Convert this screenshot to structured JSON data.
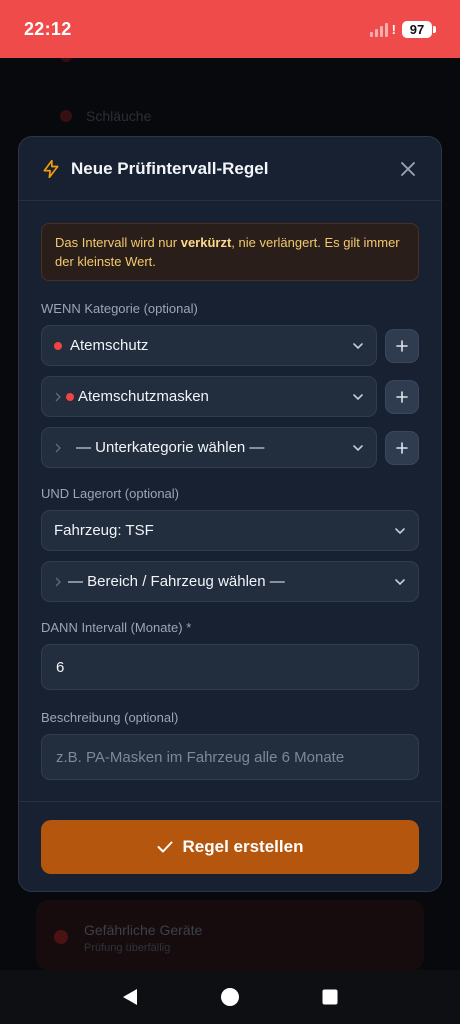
{
  "status_bar": {
    "time": "22:12",
    "battery": "97"
  },
  "background": {
    "items": [
      {
        "title": "Schläuche"
      }
    ],
    "card": {
      "title": "Gefährliche Geräte",
      "subtitle": "Prüfung überfällig"
    }
  },
  "modal": {
    "title": "Neue Prüfintervall-Regel",
    "close_icon": "close-icon",
    "header_icon": "bolt-icon",
    "accent_color": "#f59e0b",
    "info": {
      "before": "Das Intervall wird nur ",
      "bold": "verkürzt",
      "after": ", nie verlängert. Es gilt immer der kleinste Wert."
    },
    "category": {
      "label": "WENN Kategorie (optional)",
      "level1": "Atemschutz",
      "level2": "Atemschutzmasken",
      "level3": "— Unterkategorie wählen —"
    },
    "location": {
      "label": "UND Lagerort (optional)",
      "primary": "Fahrzeug: TSF",
      "secondary": "— Bereich / Fahrzeug wählen —"
    },
    "interval": {
      "label": "DANN Intervall (Monate) *",
      "value": "6"
    },
    "description": {
      "label": "Beschreibung (optional)",
      "placeholder": "z.B. PA-Masken im Fahrzeug alle 6 Monate"
    },
    "submit": {
      "label": "Regel erstellen",
      "color": "#b5560f"
    }
  }
}
